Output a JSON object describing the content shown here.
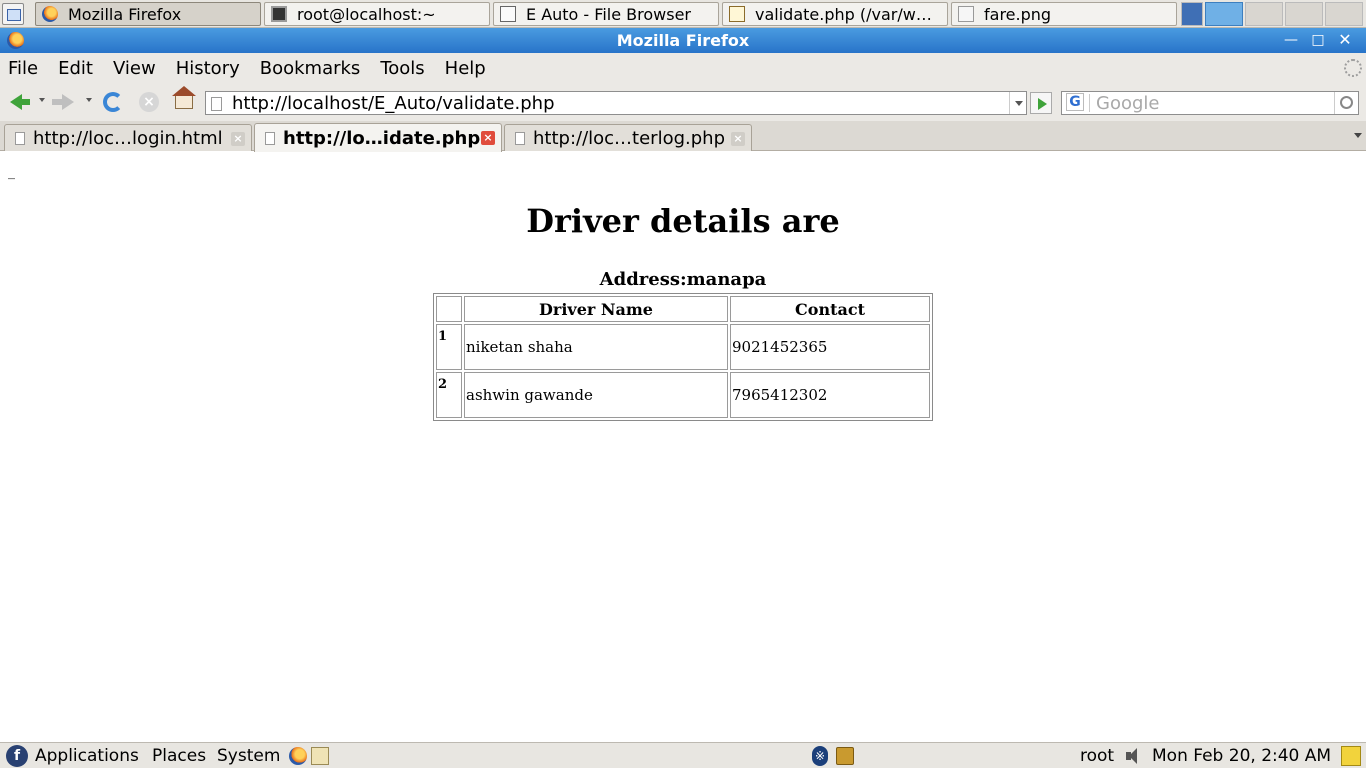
{
  "taskbar": {
    "tasks": [
      {
        "label": "Mozilla Firefox",
        "icon": "firefox-icon"
      },
      {
        "label": "root@localhost:~",
        "icon": "terminal-icon"
      },
      {
        "label": "E  Auto - File Browser",
        "icon": "folder-icon"
      },
      {
        "label": "validate.php (/var/w…",
        "icon": "text-editor-icon"
      },
      {
        "label": "fare.png",
        "icon": "image-icon"
      }
    ]
  },
  "window": {
    "title": "Mozilla Firefox"
  },
  "menubar": [
    "File",
    "Edit",
    "View",
    "History",
    "Bookmarks",
    "Tools",
    "Help"
  ],
  "navbar": {
    "url": "http://localhost/E_Auto/validate.php",
    "search_placeholder": "Google"
  },
  "tabs": [
    {
      "label": "http://loc…login.html",
      "selected": false
    },
    {
      "label": "http://lo…idate.php",
      "selected": true
    },
    {
      "label": "http://loc…terlog.php",
      "selected": false
    }
  ],
  "content": {
    "stray_text": "_",
    "heading": "Driver details are",
    "address": "Address:manapa",
    "table": {
      "headers": [
        "",
        "Driver Name",
        "Contact"
      ],
      "rows": [
        {
          "index": "1",
          "name": "niketan shaha",
          "contact": "9021452365"
        },
        {
          "index": "2",
          "name": "ashwin gawande",
          "contact": "7965412302"
        }
      ]
    }
  },
  "panel": {
    "menus": [
      "Applications",
      "Places",
      "System"
    ],
    "user": "root",
    "clock": "Mon Feb 20,  2:40 AM"
  },
  "colors": {
    "titlebar": "#2874c9",
    "accent_green": "#3fa33a",
    "tab_close_active": "#e04c3c"
  }
}
